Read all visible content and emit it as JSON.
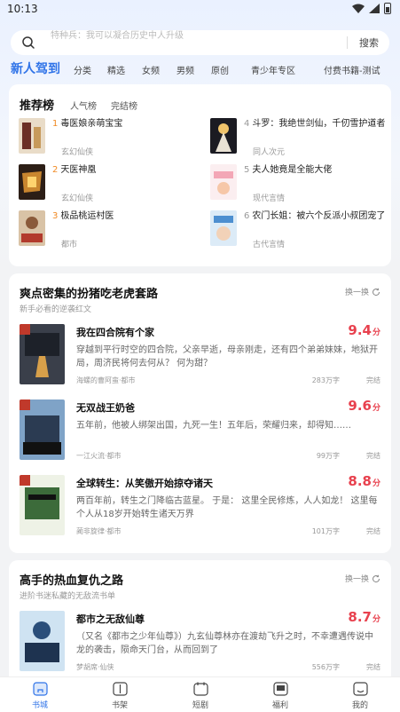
{
  "status": {
    "time": "10:13"
  },
  "search": {
    "hint": "特种兵：我可以凝合历史中人升级",
    "button": "搜索"
  },
  "nav": {
    "active": "新人驾到",
    "items": [
      "分类",
      "精选",
      "女频",
      "男频",
      "原创",
      "青少年专区",
      "付费书籍-测试"
    ]
  },
  "ranking": {
    "tabs": [
      "推荐榜",
      "人气榜",
      "完结榜"
    ],
    "items": [
      {
        "num": "1",
        "title": "毒医娘亲萌宝宝",
        "genre": "玄幻仙侠"
      },
      {
        "num": "2",
        "title": "天医神凰",
        "genre": "玄幻仙侠"
      },
      {
        "num": "3",
        "title": "极品桃运村医",
        "genre": "都市"
      },
      {
        "num": "4",
        "title": "斗罗：我绝世剑仙，千仞雪护道者",
        "genre": "同人次元"
      },
      {
        "num": "5",
        "title": "夫人她竟是全能大佬",
        "genre": "现代言情"
      },
      {
        "num": "6",
        "title": "农门长姐：被六个反派小叔团宠了",
        "genre": "古代言情"
      }
    ]
  },
  "section1": {
    "title": "爽点密集的扮猪吃老虎套路",
    "subtitle": "新手必看的逆袭红文",
    "refresh": "换一换",
    "books": [
      {
        "title": "我在四合院有个家",
        "score": "9.4",
        "unit": "分",
        "desc": "穿越到平行时空的四合院，父亲早逝，母亲刚走，还有四个弟弟妹妹，地狱开局，周济民将何去何从？ 何为甜？",
        "meta": "海螺的曹阿蛮·都市",
        "words": "283万字",
        "status": "完结"
      },
      {
        "title": "无双战王奶爸",
        "score": "9.6",
        "unit": "分",
        "desc": "五年前，他被人绑架出国，九死一生！五年后，荣耀归来，却得知……",
        "meta": "一江火流·都市",
        "words": "99万字",
        "status": "完结"
      },
      {
        "title": "全球转生：从笑傲开始掠夺诸天",
        "score": "8.8",
        "unit": "分",
        "desc": "两百年前，转生之门降临古蓝星。 于是： 这里全民修炼，人人如龙！ 这里每个人从18岁开始转生诸天万界",
        "meta": "蔺非旋律·都市",
        "words": "101万字",
        "status": "完结"
      }
    ]
  },
  "section2": {
    "title": "高手的热血复仇之路",
    "subtitle": "进阶书迷私藏的无敌流书单",
    "refresh": "换一换",
    "books": [
      {
        "title": "都市之无敌仙尊",
        "score": "8.7",
        "unit": "分",
        "desc": "（又名《都市之少年仙尊》）九玄仙尊林亦在渡劫飞升之时，不幸遭遇传说中龙的袭击，陨命天门台，从而回到了",
        "meta": "梦胡席·仙侠",
        "words": "556万字",
        "status": "完结"
      }
    ]
  },
  "tabbar": [
    {
      "label": "书城",
      "icon": "home-icon",
      "active": true
    },
    {
      "label": "书架",
      "icon": "bookshelf-icon",
      "active": false
    },
    {
      "label": "短剧",
      "icon": "drama-icon",
      "active": false
    },
    {
      "label": "福利",
      "icon": "gift-icon",
      "active": false
    },
    {
      "label": "我的",
      "icon": "profile-icon",
      "active": false
    }
  ],
  "colors": {
    "accent": "#2f73e8",
    "score": "#e8414e",
    "rank_top": "#f08a24"
  }
}
